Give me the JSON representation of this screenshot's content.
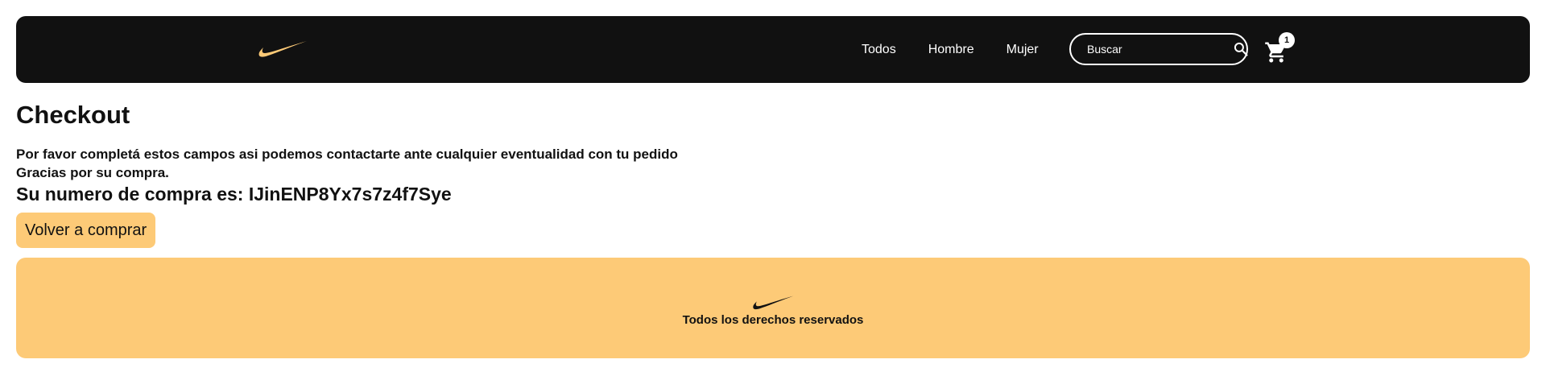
{
  "navbar": {
    "logo_icon": "nike-swoosh-icon",
    "links": [
      {
        "label": "Todos"
      },
      {
        "label": "Hombre"
      },
      {
        "label": "Mujer"
      }
    ],
    "search": {
      "placeholder": "Buscar",
      "value": "",
      "icon": "search-icon"
    },
    "cart": {
      "icon": "cart-icon",
      "count": "1"
    }
  },
  "main": {
    "title": "Checkout",
    "message_line1": "Por favor completá estos campos asi podemos contactarte ante cualquier eventualidad con tu pedido",
    "message_line2": "Gracias por su compra.",
    "order_number_text": "Su numero de compra es: IJinENP8Yx7s7z4f7Sye",
    "back_button_label": "Volver a comprar"
  },
  "footer": {
    "logo_icon": "nike-swoosh-icon",
    "text": "Todos los derechos reservados"
  },
  "colors": {
    "navbar_bg": "#111111",
    "accent": "#fdca77",
    "text": "#111111"
  }
}
